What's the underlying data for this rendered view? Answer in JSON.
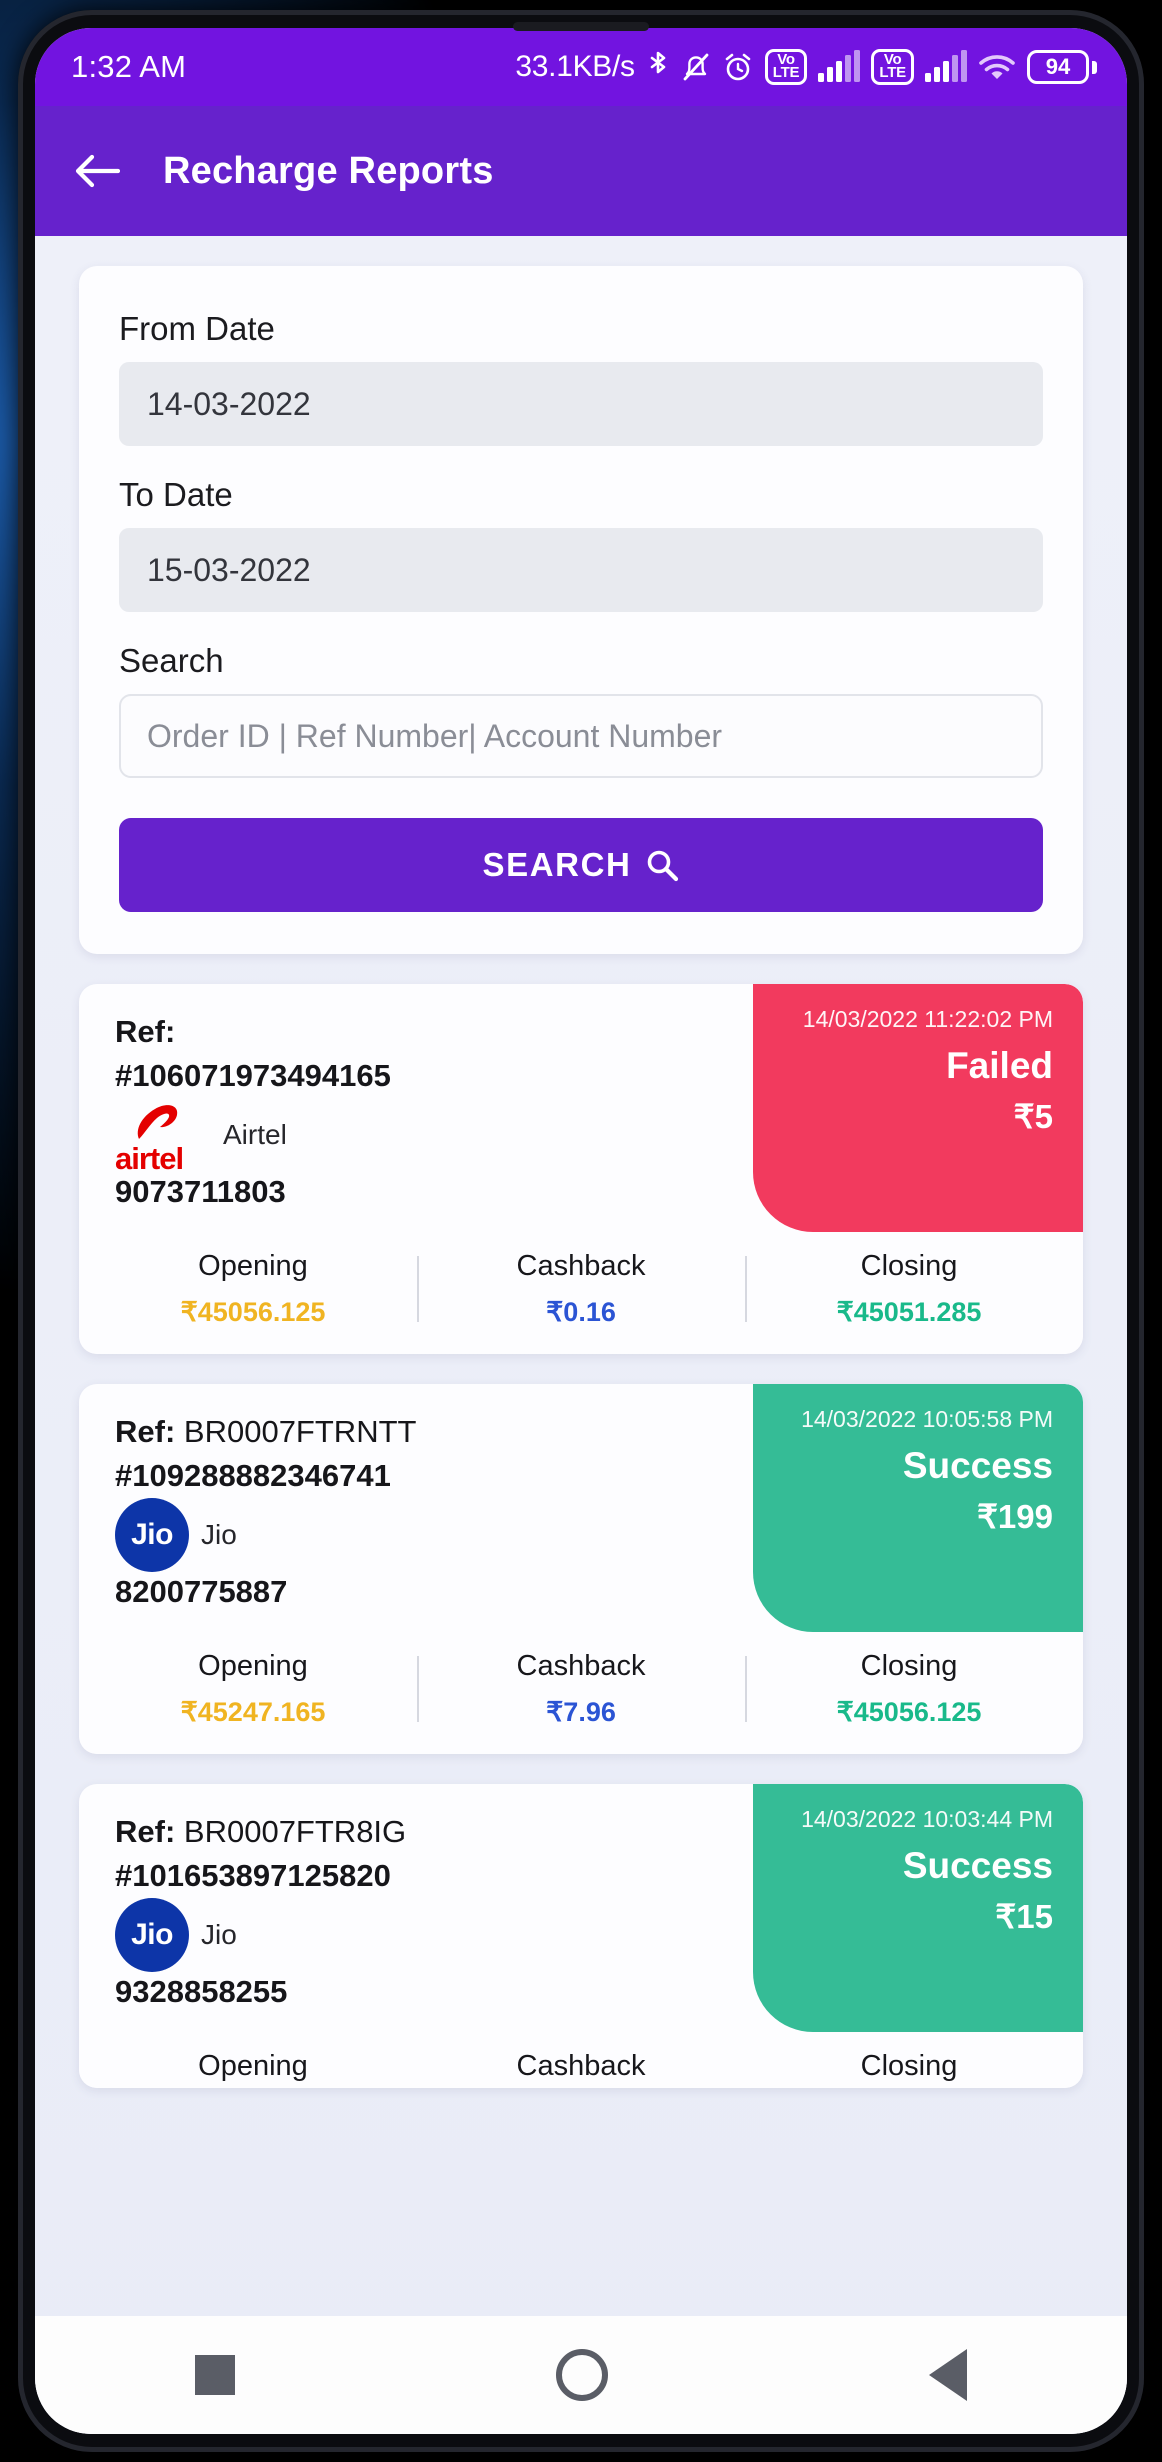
{
  "status_bar": {
    "time": "1:32 AM",
    "net_speed": "33.1KB/s",
    "icons": [
      "bluetooth-icon",
      "bell-muted-icon",
      "alarm-icon",
      "volte-icon",
      "signal-bars-icon",
      "volte-icon",
      "signal-bars-icon",
      "wifi-icon"
    ],
    "volte_top": "Vo",
    "volte_bottom": "LTE",
    "battery_level": "94"
  },
  "app_bar": {
    "back_icon": "arrow-left-icon",
    "title": "Recharge Reports"
  },
  "filter": {
    "from_date_label": "From Date",
    "from_date_value": "14-03-2022",
    "to_date_label": "To Date",
    "to_date_value": "15-03-2022",
    "search_label": "Search",
    "search_placeholder": "Order ID | Ref Number| Account Number",
    "search_value": "",
    "search_button_label": "SEARCH",
    "search_button_icon": "magnifier-icon",
    "accent_color": "#6622CC"
  },
  "balance_headers": {
    "opening": "Opening",
    "cashback": "Cashback",
    "closing": "Closing"
  },
  "status_colors": {
    "failed": "#F23A5E",
    "success": "#35BC96",
    "opening": "#F0B422",
    "cashback": "#2B54D4",
    "closing": "#19B98A"
  },
  "transactions": [
    {
      "ref_label": "Ref:",
      "ref_value": "",
      "order_id": "#106071973494165",
      "operator": "Airtel",
      "operator_logo": "airtel-logo",
      "operator_wordmark": "airtel",
      "msisdn": "9073711803",
      "datetime": "14/03/2022 11:22:02 PM",
      "status": "Failed",
      "status_kind": "failed",
      "amount": "₹5",
      "opening": "₹45056.125",
      "cashback": "₹0.16",
      "closing": "₹45051.285"
    },
    {
      "ref_label": "Ref:",
      "ref_value": "BR0007FTRNTT",
      "order_id": "#109288882346741",
      "operator": "Jio",
      "operator_logo": "jio-logo",
      "operator_wordmark": "Jio",
      "msisdn": "8200775887",
      "datetime": "14/03/2022 10:05:58 PM",
      "status": "Success",
      "status_kind": "success",
      "amount": "₹199",
      "opening": "₹45247.165",
      "cashback": "₹7.96",
      "closing": "₹45056.125"
    },
    {
      "ref_label": "Ref:",
      "ref_value": "BR0007FTR8IG",
      "order_id": "#101653897125820",
      "operator": "Jio",
      "operator_logo": "jio-logo",
      "operator_wordmark": "Jio",
      "msisdn": "9328858255",
      "datetime": "14/03/2022 10:03:44 PM",
      "status": "Success",
      "status_kind": "success",
      "amount": "₹15",
      "opening": "",
      "cashback": "",
      "closing": ""
    }
  ],
  "nav_bar": {
    "recents_icon": "square-icon",
    "home_icon": "circle-icon",
    "back_icon": "triangle-back-icon"
  }
}
